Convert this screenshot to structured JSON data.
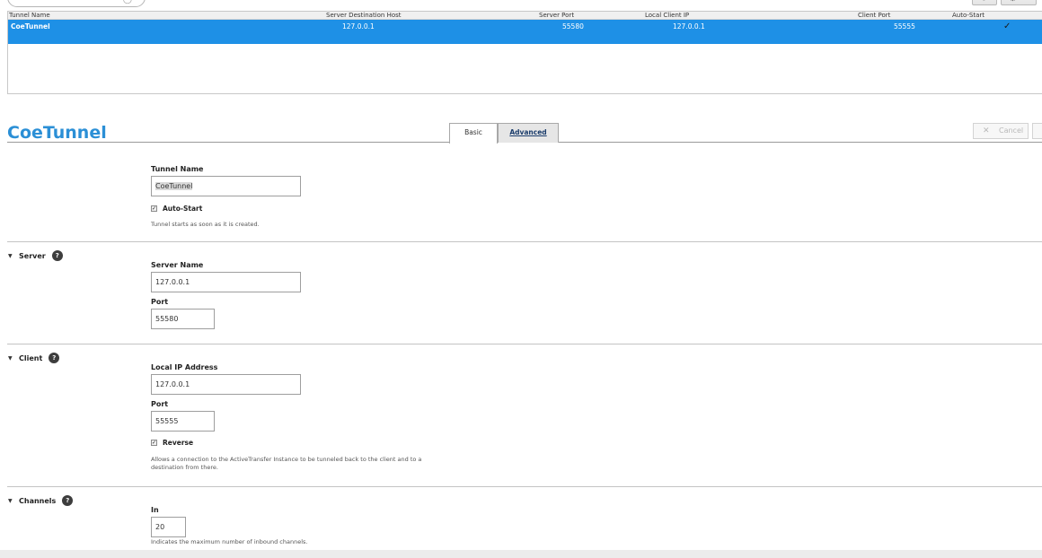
{
  "table": {
    "headers": [
      "Tunnel Name",
      "Server Destination Host",
      "Server Port",
      "Local Client IP",
      "Client Port",
      "Auto-Start"
    ],
    "rows": [
      {
        "tunnel_name": "CoeTunnel",
        "server_host": "127.0.0.1",
        "server_port": "55580",
        "local_ip": "127.0.0.1",
        "client_port": "55555",
        "auto_start": "✓"
      }
    ]
  },
  "detail": {
    "title": "CoeTunnel",
    "tabs": [
      {
        "label": "Basic",
        "active": true
      },
      {
        "label": "Advanced",
        "active": false
      }
    ],
    "cancel_label": "Cancel"
  },
  "form": {
    "tunnel_name_label": "Tunnel Name",
    "tunnel_name_value": "CoeTunnel",
    "auto_start_label": "Auto-Start",
    "auto_start_help": "Tunnel starts as soon as it is created.",
    "server": {
      "section": "Server",
      "name_label": "Server Name",
      "name_value": "127.0.0.1",
      "port_label": "Port",
      "port_value": "55580"
    },
    "client": {
      "section": "Client",
      "ip_label": "Local IP Address",
      "ip_value": "127.0.0.1",
      "port_label": "Port",
      "port_value": "55555",
      "reverse_label": "Reverse",
      "reverse_help_1": "Allows a connection to the ActiveTransfer Instance to be tunneled back to the client and to a",
      "reverse_help_2": "destination from there."
    },
    "channels": {
      "section": "Channels",
      "in_label": "In",
      "in_value": "20",
      "in_help": "Indicates the maximum number of inbound channels."
    },
    "help_badge": "?"
  }
}
